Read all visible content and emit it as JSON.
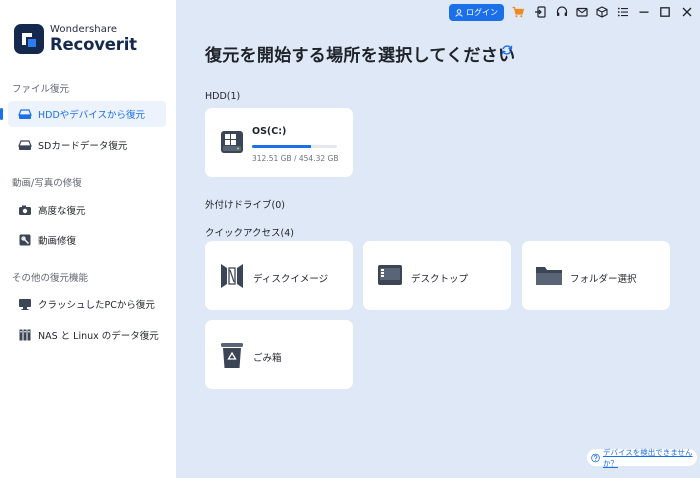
{
  "app": {
    "brand": "Wondershare",
    "product": "Recoverit"
  },
  "colors": {
    "accent": "#1b6fe8",
    "sidebar_bg": "#ffffff",
    "main_bg": "#dfe8f6",
    "card_bg": "#ffffff",
    "logo_bg": "#14294d"
  },
  "sidebar": {
    "sections": [
      {
        "title": "ファイル復元",
        "items": [
          {
            "label": "HDDやデバイスから復元",
            "icon": "hdd-icon",
            "active": true
          },
          {
            "label": "SDカードデータ復元",
            "icon": "sd-card-icon"
          }
        ]
      },
      {
        "title": "動画/写真の修復",
        "items": [
          {
            "label": "高度な復元",
            "icon": "camera-icon"
          },
          {
            "label": "動画修復",
            "icon": "video-repair-icon"
          }
        ]
      },
      {
        "title": "その他の復元機能",
        "items": [
          {
            "label": "クラッシュしたPCから復元",
            "icon": "monitor-icon"
          },
          {
            "label": "NAS と Linux のデータ復元",
            "icon": "nas-icon"
          }
        ]
      }
    ]
  },
  "topbar": {
    "login_label": "ログイン",
    "icons": [
      "cart-icon",
      "signin-icon",
      "headset-icon",
      "mail-icon",
      "box-icon",
      "menu-icon",
      "minimize-icon",
      "maximize-icon",
      "close-icon"
    ]
  },
  "main": {
    "title": "復元を開始する場所を選択してください",
    "hdd_label": "HDD(1)",
    "drive": {
      "name": "OS(C:)",
      "used_fraction": 0.69,
      "size_text": "312.51 GB / 454.32 GB"
    },
    "external_label": "外付けドライブ(0)",
    "quick_label": "クイックアクセス(4)",
    "quick_items": [
      {
        "label": "ディスクイメージ",
        "icon": "disk-image-icon"
      },
      {
        "label": "デスクトップ",
        "icon": "desktop-icon"
      },
      {
        "label": "フォルダー選択",
        "icon": "folder-icon"
      },
      {
        "label": "ごみ箱",
        "icon": "recycle-bin-icon"
      }
    ]
  },
  "footer": {
    "help_link": "デバイスを検出できませんか？"
  }
}
